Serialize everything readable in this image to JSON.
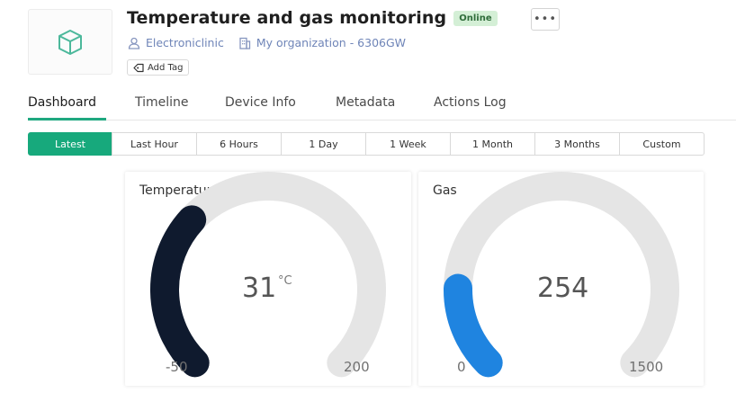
{
  "header": {
    "title": "Temperature and gas monitoring",
    "status": "Online",
    "more_label": "•••",
    "owner": "Electroniclinic",
    "organization": "My organization - 6306GW",
    "add_tag_label": "Add Tag"
  },
  "tabs": [
    {
      "label": "Dashboard",
      "active": true
    },
    {
      "label": "Timeline",
      "active": false
    },
    {
      "label": "Device Info",
      "active": false
    },
    {
      "label": "Metadata",
      "active": false
    },
    {
      "label": "Actions Log",
      "active": false
    }
  ],
  "time_ranges": [
    {
      "label": "Latest",
      "active": true
    },
    {
      "label": "Last Hour",
      "active": false
    },
    {
      "label": "6 Hours",
      "active": false
    },
    {
      "label": "1 Day",
      "active": false
    },
    {
      "label": "1 Week",
      "active": false
    },
    {
      "label": "1 Month",
      "active": false
    },
    {
      "label": "3 Months",
      "active": false
    },
    {
      "label": "Custom",
      "active": false
    }
  ],
  "widgets": {
    "temperature": {
      "title": "Temperature",
      "value": "31",
      "unit": "°C",
      "min": "-50",
      "max": "200",
      "numeric_value": 31,
      "numeric_min": -50,
      "numeric_max": 200,
      "color": "#0f1a2e"
    },
    "gas": {
      "title": "Gas",
      "value": "254",
      "min": "0",
      "max": "1500",
      "numeric_value": 254,
      "numeric_min": 0,
      "numeric_max": 1500,
      "color": "#1f84e0"
    }
  },
  "colors": {
    "accent": "#17a97c",
    "link": "#6f85b8",
    "gauge_track": "#e5e5e5",
    "online_badge_bg": "#d4efd6"
  },
  "icons": {
    "device": "cube-icon",
    "owner": "user-icon",
    "organization": "building-icon",
    "tag": "tag-icon",
    "more": "more-icon"
  }
}
